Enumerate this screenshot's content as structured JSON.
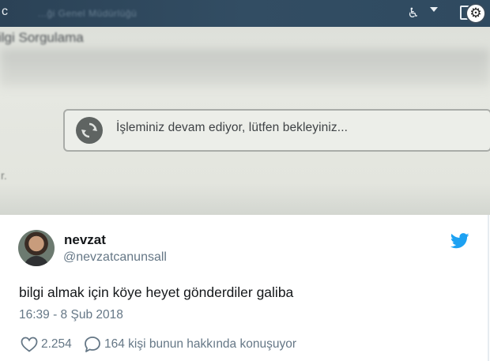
{
  "photo": {
    "topbar_left_letter": "c",
    "blurred_title": "...ği Genel Müdürlüğü",
    "page_title": "ilgi Sorgulama",
    "loading_message": "İşleminiz devam ediyor, lütfen bekleyiniz...",
    "edge_text": "r."
  },
  "tweet": {
    "display_name": "nevzat",
    "handle": "@nevzatcanunsall",
    "text": "bilgi almak için köye heyet gönderdiler galiba",
    "timestamp": "16:39 - 8 Şub 2018",
    "likes": "2.254",
    "replies_text": "164 kişi bunun hakkında konuşuyor",
    "brand_color": "#1da1f2"
  }
}
